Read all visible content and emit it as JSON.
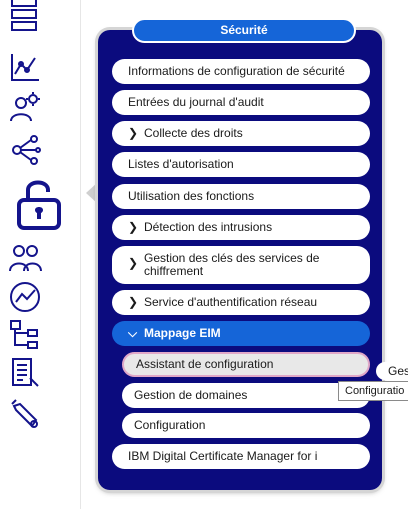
{
  "panel": {
    "title": "Sécurité",
    "items": [
      {
        "label": "Informations de configuration de sécurité"
      },
      {
        "label": "Entrées du journal d'audit"
      },
      {
        "label": "Collecte des droits",
        "chevron": "chevron-right"
      },
      {
        "label": "Listes d'autorisation"
      },
      {
        "label": "Utilisation des fonctions"
      },
      {
        "label": "Détection des intrusions",
        "chevron": "chevron-right"
      },
      {
        "label": "Gestion des clés des services de chiffrement",
        "chevron": "chevron-right"
      },
      {
        "label": "Service d'authentification réseau",
        "chevron": "chevron-right"
      },
      {
        "label": "Mappage EIM",
        "chevron": "chevron-down",
        "expanded": true
      },
      {
        "label": "IBM Digital Certificate Manager for i"
      }
    ],
    "eim_subitems": [
      {
        "label": "Assistant de configuration",
        "hovered": true
      },
      {
        "label": "Gestion de domaines"
      },
      {
        "label": "Configuration"
      }
    ]
  },
  "tooltip": {
    "text": "Configuratio"
  },
  "peek_menu": {
    "text": "Ges"
  },
  "rail_icons": [
    "server-list-icon",
    "line-chart-icon",
    "user-settings-icon",
    "network-nodes-icon",
    "security-lock-icon",
    "users-group-icon",
    "performance-gauge-icon",
    "hierarchy-icon",
    "journal-icon",
    "tools-icon"
  ],
  "colors": {
    "panel_bg": "#0b0b7e",
    "accent": "#1565d8",
    "icon": "#14148c",
    "hover_border": "#e0a8c8"
  }
}
